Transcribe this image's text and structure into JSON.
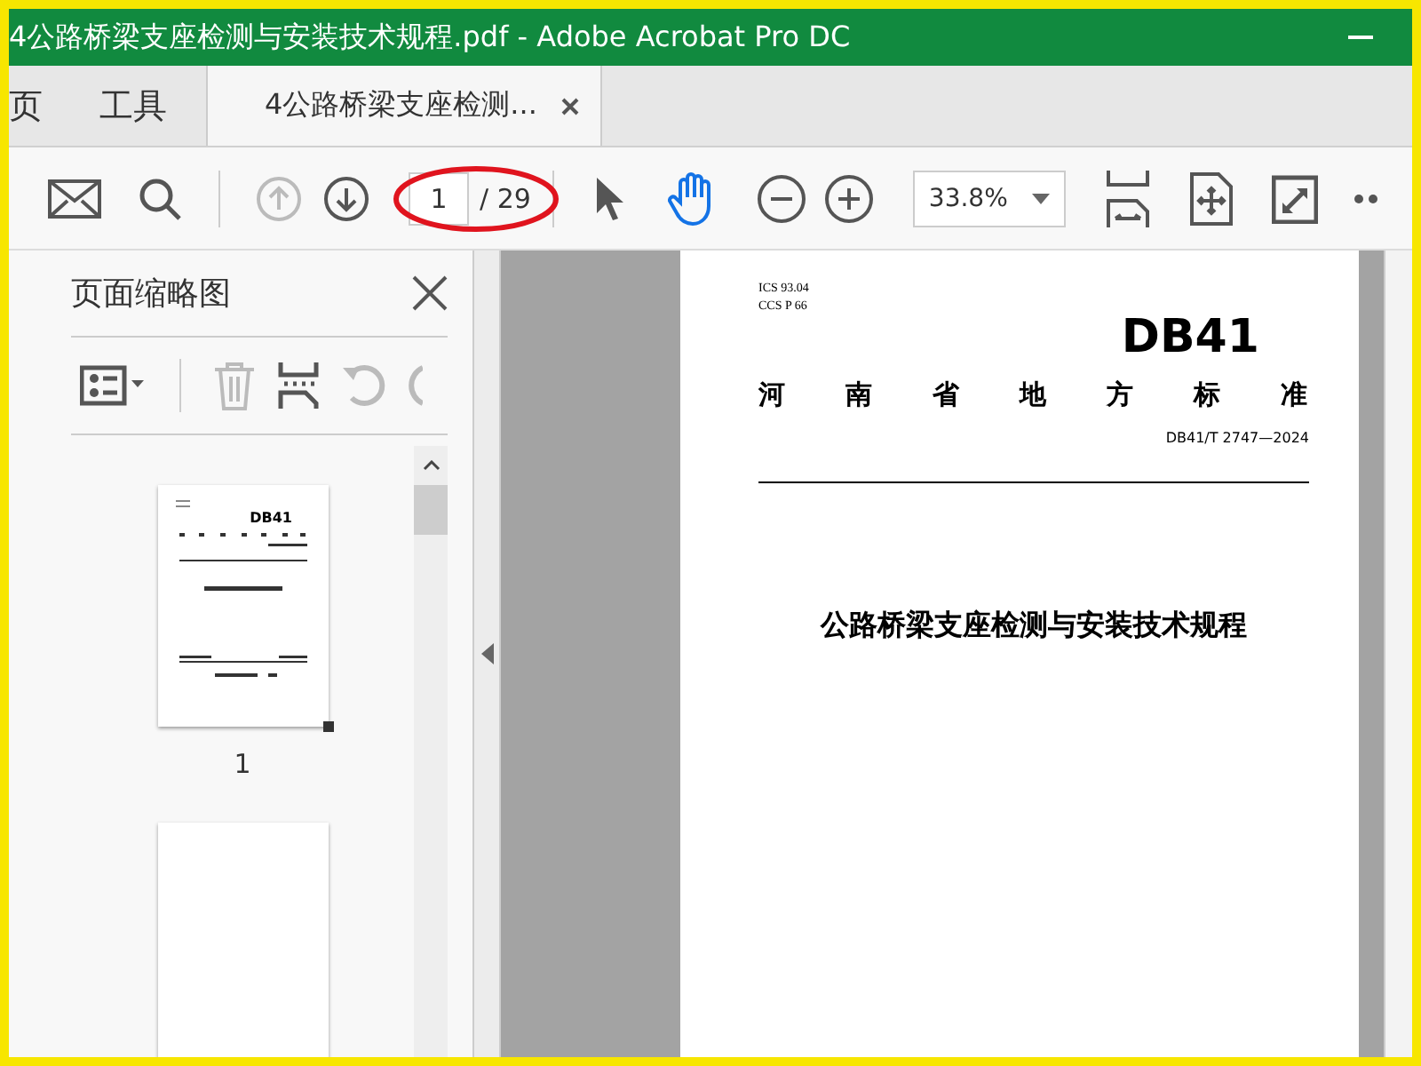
{
  "window": {
    "title": "4公路桥梁支座检测与安装技术规程.pdf - Adobe Acrobat Pro DC"
  },
  "tabs": [
    {
      "label": "页",
      "selected": false,
      "closable": false
    },
    {
      "label": "工具",
      "selected": false,
      "closable": false
    },
    {
      "label": "4公路桥梁支座检测...",
      "selected": true,
      "closable": true
    }
  ],
  "toolbar": {
    "nav": [
      {
        "kind": "up",
        "disabled": true
      },
      {
        "kind": "down",
        "disabled": false
      }
    ],
    "page_input": {
      "value": "1"
    },
    "page_count": "/ 29",
    "tools": [
      {
        "kind": "select",
        "selected": false
      },
      {
        "kind": "hand",
        "selected": true
      }
    ],
    "zoom": {
      "value": "33.8%"
    }
  },
  "annotations": [
    {
      "kind": "ellipse"
    }
  ],
  "sidebar": {
    "title": "页面缩略图",
    "tools": [
      {
        "kind": "options",
        "disabled": false
      },
      {
        "kind": "delete",
        "disabled": true
      },
      {
        "kind": "extract",
        "disabled": false
      },
      {
        "kind": "rotate-left",
        "disabled": true
      },
      {
        "kind": "rotate-right",
        "disabled": true
      }
    ],
    "thumbnails": [
      {
        "label": "1",
        "heading": "DB41",
        "kind": "cover"
      },
      {
        "kind": "blank"
      }
    ]
  },
  "document": {
    "ics": "ICS 93.04",
    "ccs": "CCS P 66",
    "code": "DB41",
    "category": "河南省地方标准",
    "number": "DB41/T 2747—2024",
    "title": "公路桥梁支座检测与安装技术规程"
  }
}
